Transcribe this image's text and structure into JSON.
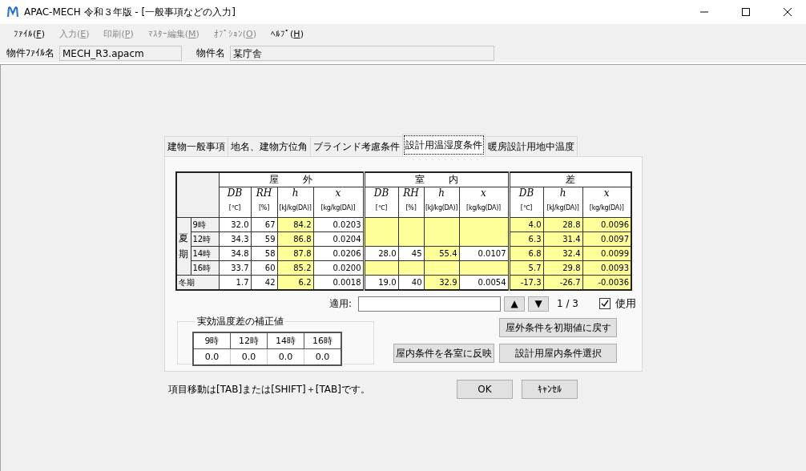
{
  "window": {
    "title": "APAC-MECH 令和３年版 - [一般事項などの入力]"
  },
  "menu": [
    {
      "before": "ﾌｧｲﾙ(",
      "key": "F",
      "after": ")",
      "disabled": false
    },
    {
      "before": "入力(",
      "key": "E",
      "after": ")",
      "disabled": true
    },
    {
      "before": "印刷(",
      "key": "P",
      "after": ")",
      "disabled": true
    },
    {
      "before": "ﾏｽﾀｰ編集(",
      "key": "M",
      "after": ")",
      "disabled": true
    },
    {
      "before": "ｵﾌﾟｼｮﾝ(",
      "key": "O",
      "after": ")",
      "disabled": true
    },
    {
      "before": "ﾍﾙﾌﾟ(",
      "key": "H",
      "after": ")",
      "disabled": false
    }
  ],
  "fields": [
    {
      "label": "物件ﾌｧｲﾙ名",
      "value": "MECH_R3.apacm"
    },
    {
      "label": "物件名",
      "value": "某庁舎"
    }
  ],
  "tabs": [
    {
      "label": "建物一般事項",
      "selected": false
    },
    {
      "label": "地名、建物方位角",
      "selected": false
    },
    {
      "label": "ブラインド考慮条件",
      "selected": false
    },
    {
      "label": "設計用温湿度条件",
      "selected": true
    },
    {
      "label": "暖房設計用地中温度",
      "selected": false
    }
  ],
  "table": {
    "groups": [
      {
        "label": "屋外",
        "columns": [
          {
            "symbol": "DB",
            "unit": "[℃]"
          },
          {
            "symbol": "RH",
            "unit": "[%]"
          },
          {
            "symbol": "h",
            "unit": "[kJ/kg(DA)]"
          },
          {
            "symbol": "x",
            "unit": "[kg/kg(DA)]"
          }
        ]
      },
      {
        "label": "室内",
        "columns": [
          {
            "symbol": "DB",
            "unit": "[℃]"
          },
          {
            "symbol": "RH",
            "unit": "[%]"
          },
          {
            "symbol": "h",
            "unit": "[kJ/kg(DA)]"
          },
          {
            "symbol": "x",
            "unit": "[kg/kg(DA)]"
          }
        ]
      },
      {
        "label": "差",
        "columns": [
          {
            "symbol": "DB",
            "unit": "[℃]"
          },
          {
            "symbol": "h",
            "unit": "[kJ/kg(DA)]"
          },
          {
            "symbol": "x",
            "unit": "[kg/kg(DA)]"
          }
        ]
      }
    ],
    "seasons": [
      {
        "label": "夏期",
        "rows": [
          {
            "time": "9時",
            "cells": [
              {
                "text": "32.0",
                "highlight": false
              },
              {
                "text": "67",
                "highlight": false
              },
              {
                "text": "84.2",
                "highlight": true
              },
              {
                "text": "0.0203",
                "highlight": false
              },
              {
                "highlight": true
              },
              {
                "highlight": true
              },
              {
                "highlight": true
              },
              {
                "highlight": true
              },
              {
                "text": "4.0",
                "highlight": true
              },
              {
                "text": "28.8",
                "highlight": true
              },
              {
                "text": "0.0096",
                "highlight": true
              }
            ]
          },
          {
            "time": "12時",
            "cells": [
              {
                "text": "34.3",
                "highlight": false
              },
              {
                "text": "59",
                "highlight": false
              },
              {
                "text": "86.8",
                "highlight": true
              },
              {
                "text": "0.0204",
                "highlight": false
              },
              {
                "highlight": true
              },
              {
                "highlight": true
              },
              {
                "highlight": true
              },
              {
                "highlight": true
              },
              {
                "text": "6.3",
                "highlight": true
              },
              {
                "text": "31.4",
                "highlight": true
              },
              {
                "text": "0.0097",
                "highlight": true
              }
            ]
          },
          {
            "time": "14時",
            "cells": [
              {
                "text": "34.8",
                "highlight": false
              },
              {
                "text": "58",
                "highlight": false
              },
              {
                "text": "87.8",
                "highlight": true
              },
              {
                "text": "0.0206",
                "highlight": false
              },
              {
                "text": "28.0",
                "highlight": false
              },
              {
                "text": "45",
                "highlight": false
              },
              {
                "text": "55.4",
                "highlight": true
              },
              {
                "text": "0.0107",
                "highlight": false
              },
              {
                "text": "6.8",
                "highlight": true
              },
              {
                "text": "32.4",
                "highlight": true
              },
              {
                "text": "0.0099",
                "highlight": true
              }
            ]
          },
          {
            "time": "16時",
            "cells": [
              {
                "text": "33.7",
                "highlight": false
              },
              {
                "text": "60",
                "highlight": false
              },
              {
                "text": "85.2",
                "highlight": true
              },
              {
                "text": "0.0200",
                "highlight": false
              },
              {
                "highlight": true
              },
              {
                "highlight": true
              },
              {
                "highlight": true
              },
              {
                "highlight": true
              },
              {
                "text": "5.7",
                "highlight": true
              },
              {
                "text": "29.8",
                "highlight": true
              },
              {
                "text": "0.0093",
                "highlight": true
              }
            ]
          }
        ]
      },
      {
        "label": "冬期",
        "rows": [
          {
            "cells": [
              {
                "text": "1.7",
                "highlight": false
              },
              {
                "text": "42",
                "highlight": false
              },
              {
                "text": "6.2",
                "highlight": true
              },
              {
                "text": "0.0018",
                "highlight": false
              },
              {
                "text": "19.0",
                "highlight": false
              },
              {
                "text": "40",
                "highlight": false
              },
              {
                "text": "32.9",
                "highlight": true
              },
              {
                "text": "0.0054",
                "highlight": false
              },
              {
                "text": "-17.3",
                "highlight": true
              },
              {
                "text": "-26.7",
                "highlight": true
              },
              {
                "text": "-0.0036",
                "highlight": true
              }
            ]
          }
        ]
      }
    ]
  },
  "apply": {
    "label": "適用:",
    "up": "▲",
    "down": "▼",
    "count": "1 / 3",
    "use": {
      "label": "使用",
      "checked": true
    }
  },
  "correction": {
    "title": "実効温度差の補正値",
    "headers": [
      "9時",
      "12時",
      "14時",
      "16時"
    ],
    "values": [
      "0.0",
      "0.0",
      "0.0",
      "0.0"
    ]
  },
  "actions": [
    "屋外条件を初期値に戻す",
    "屋内条件を各室に反映",
    "設計用屋内条件選択"
  ],
  "hint": "項目移動は[TAB]または[SHIFT]＋[TAB]です。",
  "buttons": [
    "OK",
    "ｷｬﾝｾﾙ"
  ]
}
